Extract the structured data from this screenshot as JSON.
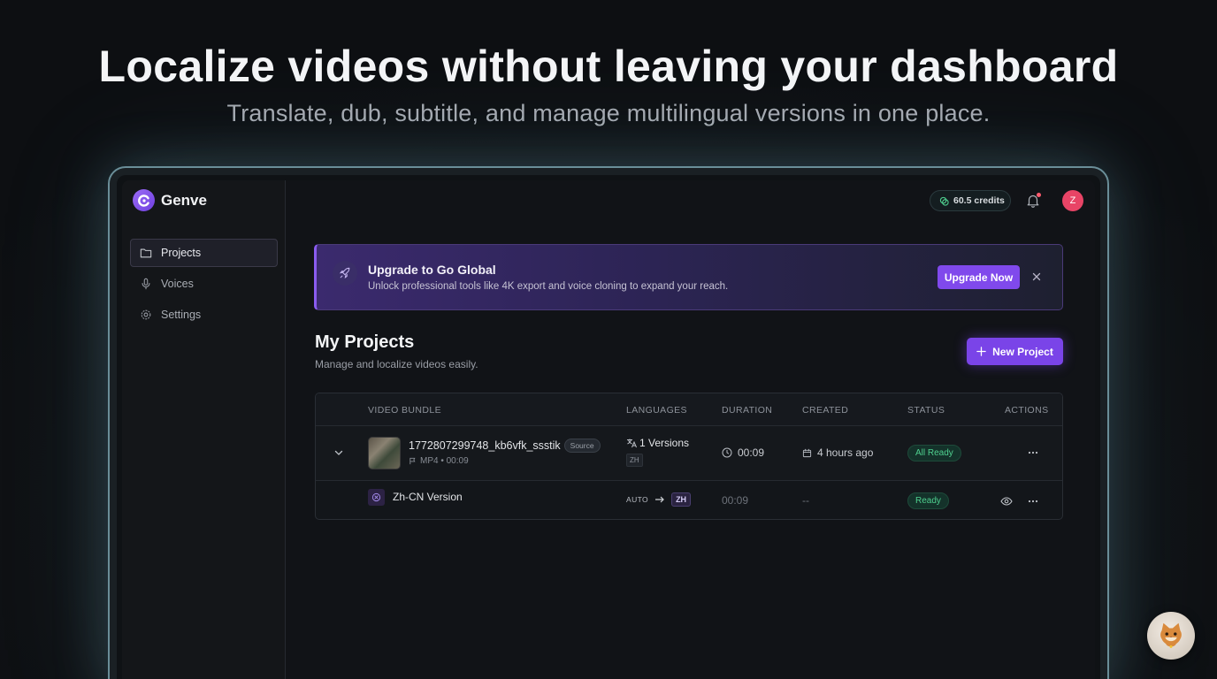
{
  "hero": {
    "title": "Localize videos without leaving your dashboard",
    "subtitle": "Translate, dub, subtitle, and manage multilingual versions in one place."
  },
  "app": {
    "name": "Genve",
    "accent": "#8049ec"
  },
  "sidebar": {
    "items": [
      {
        "label": "Projects",
        "icon": "folder-icon",
        "active": true
      },
      {
        "label": "Voices",
        "icon": "microphone-icon",
        "active": false
      },
      {
        "label": "Settings",
        "icon": "gear-icon",
        "active": false
      }
    ]
  },
  "topbar": {
    "credits": "60.5 credits",
    "avatar_initial": "Z"
  },
  "banner": {
    "title": "Upgrade to Go Global",
    "text": "Unlock professional tools like 4K export and voice cloning to expand your reach.",
    "button": "Upgrade Now"
  },
  "projects": {
    "title": "My Projects",
    "subtitle": "Manage and localize videos easily.",
    "new_button": "New Project"
  },
  "table": {
    "headers": [
      "VIDEO BUNDLE",
      "LANGUAGES",
      "DURATION",
      "CREATED",
      "STATUS",
      "ACTIONS"
    ],
    "bundle": {
      "filename": "1772807299748_kb6vfk_ssstik",
      "source_badge": "Source",
      "meta": "MP4 • 00:09",
      "versions": "1 Versions",
      "lang_chip": "ZH",
      "duration": "00:09",
      "created": "4 hours ago",
      "status": "All Ready"
    },
    "version": {
      "name": "Zh-CN Version",
      "from": "AUTO",
      "to": "ZH",
      "duration": "00:09",
      "created": "--",
      "status": "Ready"
    }
  }
}
